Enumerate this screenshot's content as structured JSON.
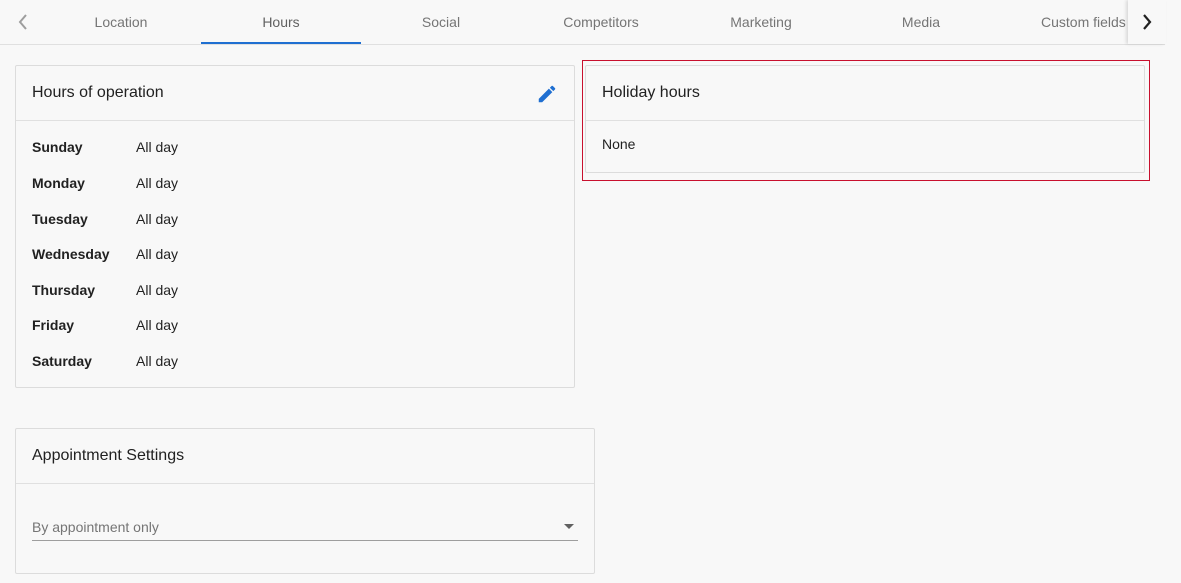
{
  "tabs": [
    "Location",
    "Hours",
    "Social",
    "Competitors",
    "Marketing",
    "Media",
    "Custom fields"
  ],
  "active_tab": "Hours",
  "accent_color": "#1f6fd1",
  "highlight_color": "#c8102e",
  "hours_card": {
    "title": "Hours of operation",
    "edit_icon": "pencil-icon",
    "days": [
      {
        "day": "Sunday",
        "hours": "All day"
      },
      {
        "day": "Monday",
        "hours": "All day"
      },
      {
        "day": "Tuesday",
        "hours": "All day"
      },
      {
        "day": "Wednesday",
        "hours": "All day"
      },
      {
        "day": "Thursday",
        "hours": "All day"
      },
      {
        "day": "Friday",
        "hours": "All day"
      },
      {
        "day": "Saturday",
        "hours": "All day"
      }
    ]
  },
  "holiday_card": {
    "title": "Holiday hours",
    "value": "None"
  },
  "appointment_card": {
    "title": "Appointment Settings",
    "select_value": "By appointment only"
  }
}
